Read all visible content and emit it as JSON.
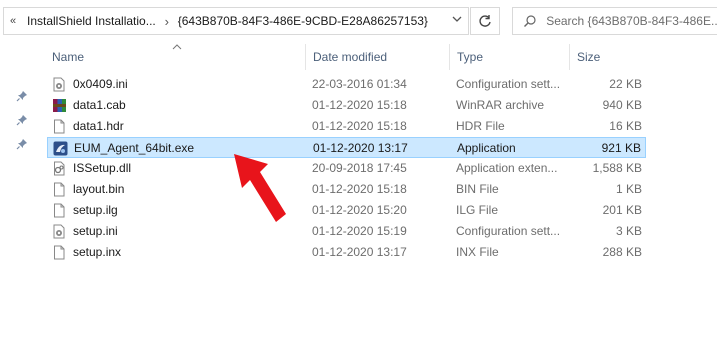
{
  "address": {
    "overflow": "«",
    "crumbs": [
      "InstallShield Installatio...",
      "{643B870B-84F3-486E-9CBD-E28A86257153}"
    ],
    "separator": "›"
  },
  "search": {
    "placeholder": "Search {643B870B-84F3-486E..."
  },
  "columns": {
    "name": "Name",
    "date": "Date modified",
    "type": "Type",
    "size": "Size"
  },
  "files": [
    {
      "name": "0x0409.ini",
      "date": "22-03-2016 01:34",
      "type": "Configuration sett...",
      "size": "22 KB",
      "icon": "ini-file-icon"
    },
    {
      "name": "data1.cab",
      "date": "01-12-2020 15:18",
      "type": "WinRAR archive",
      "size": "940 KB",
      "icon": "winrar-archive-icon"
    },
    {
      "name": "data1.hdr",
      "date": "01-12-2020 15:18",
      "type": "HDR File",
      "size": "16 KB",
      "icon": "blank-file-icon"
    },
    {
      "name": "EUM_Agent_64bit.exe",
      "date": "01-12-2020 13:17",
      "type": "Application",
      "size": "921 KB",
      "icon": "application-icon"
    },
    {
      "name": "ISSetup.dll",
      "date": "20-09-2018 17:45",
      "type": "Application exten...",
      "size": "1,588 KB",
      "icon": "dll-file-icon"
    },
    {
      "name": "layout.bin",
      "date": "01-12-2020 15:18",
      "type": "BIN File",
      "size": "1 KB",
      "icon": "blank-file-icon"
    },
    {
      "name": "setup.ilg",
      "date": "01-12-2020 15:20",
      "type": "ILG File",
      "size": "201 KB",
      "icon": "blank-file-icon"
    },
    {
      "name": "setup.ini",
      "date": "01-12-2020 15:19",
      "type": "Configuration sett...",
      "size": "3 KB",
      "icon": "ini-file-icon"
    },
    {
      "name": "setup.inx",
      "date": "01-12-2020 13:17",
      "type": "INX File",
      "size": "288 KB",
      "icon": "blank-file-icon"
    }
  ],
  "selected_row": "EUM_Agent_64bit.exe",
  "colors": {
    "selection": "#cce8ff",
    "selection_border": "#99d1ff",
    "arrow": "#e8141b",
    "header_text": "#4c607a"
  }
}
